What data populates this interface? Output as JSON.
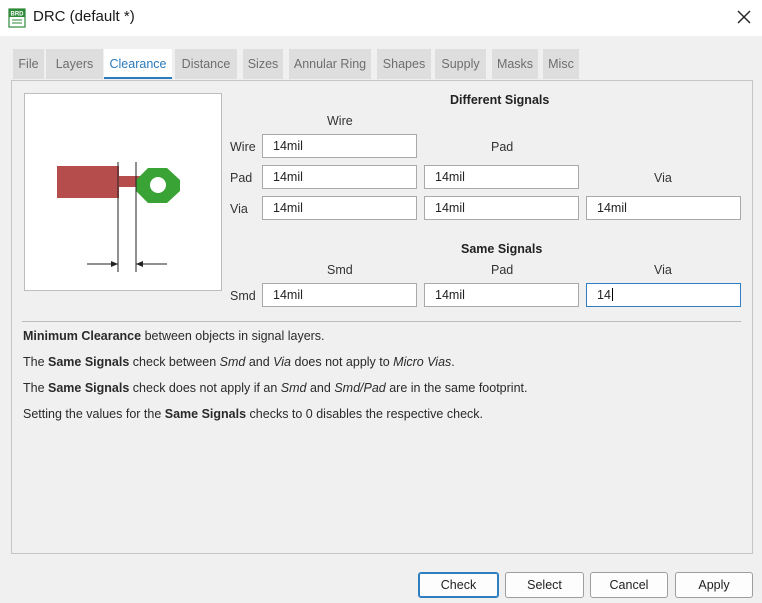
{
  "window": {
    "icon_text": "BRD",
    "title": "DRC (default *)"
  },
  "tabs": [
    {
      "label": "File"
    },
    {
      "label": "Layers"
    },
    {
      "label": "Clearance"
    },
    {
      "label": "Distance"
    },
    {
      "label": "Sizes"
    },
    {
      "label": "Annular Ring"
    },
    {
      "label": "Shapes"
    },
    {
      "label": "Supply"
    },
    {
      "label": "Masks"
    },
    {
      "label": "Misc"
    }
  ],
  "active_tab": "Clearance",
  "different_signals": {
    "heading": "Different Signals",
    "col_wire": "Wire",
    "col_pad": "Pad",
    "col_via": "Via",
    "row_wire": "Wire",
    "row_pad": "Pad",
    "row_via": "Via",
    "wire_wire": "14mil",
    "pad_wire": "14mil",
    "pad_pad": "14mil",
    "via_wire": "14mil",
    "via_pad": "14mil",
    "via_via": "14mil"
  },
  "same_signals": {
    "heading": "Same Signals",
    "col_smd": "Smd",
    "col_pad": "Pad",
    "col_via": "Via",
    "row_smd": "Smd",
    "smd_smd": "14mil",
    "smd_pad": "14mil",
    "smd_via": "14"
  },
  "info": {
    "line1": {
      "b1": "Minimum Clearance",
      "t1": " between objects in signal layers."
    },
    "line2": {
      "t1": "The ",
      "b1": "Same Signals",
      "t2": " check between ",
      "i1": "Smd",
      "t3": " and ",
      "i2": "Via",
      "t4": " does not apply to ",
      "i3": "Micro Vias",
      "t5": "."
    },
    "line3": {
      "t1": "The ",
      "b1": "Same Signals",
      "t2": " check does not apply if an ",
      "i1": "Smd",
      "t3": " and ",
      "i2": "Smd/Pad",
      "t4": " are in the same footprint."
    },
    "line4": {
      "t1": "Setting the values for the ",
      "b1": "Same Signals",
      "t2": " checks to 0 disables the respective check."
    }
  },
  "buttons": {
    "check": "Check",
    "select": "Select",
    "cancel": "Cancel",
    "apply": "Apply"
  },
  "colors": {
    "accent": "#2a7bbd",
    "wire": "#b54d4d",
    "pad": "#3aa335"
  }
}
